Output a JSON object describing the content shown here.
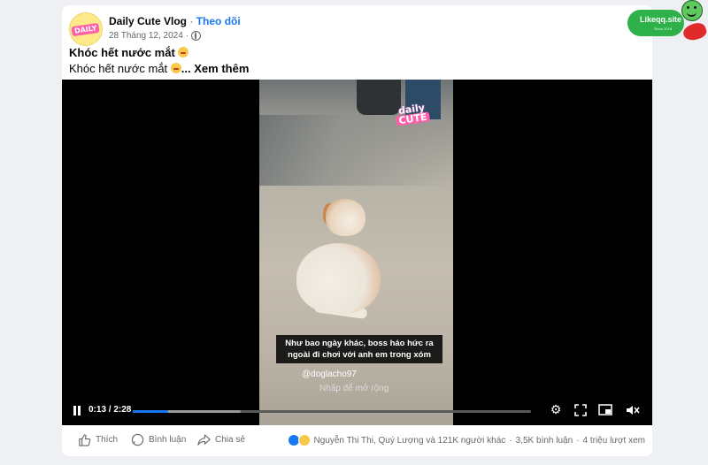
{
  "post": {
    "author": "Daily Cute Vlog",
    "separator": "·",
    "follow_label": "Theo dõi",
    "timestamp": "28 Tháng 12, 2024",
    "title": "Khóc hết nước mắt",
    "description": "Khóc hết nước mắt",
    "see_more_label": "... Xem thêm",
    "avatar_text": "DAILY"
  },
  "video": {
    "caption": "Như bao ngày khác, boss háo hức ra ngoài đi chơi với anh em trong xóm",
    "handle": "@doglacho97",
    "expand_hint": "Nhấp để mở rộng",
    "time": "0:13 / 2:28",
    "progress_fraction": 0.088,
    "buffered_fraction": 0.27,
    "logo_line1": "daily",
    "logo_line2": "CUTE"
  },
  "actions": {
    "like_label": "Thích",
    "comment_label": "Bình luận",
    "share_label": "Chia sẻ"
  },
  "reactions": {
    "summary": "Nguyễn Thi Thi, Quý Lượng và 121K người khác",
    "comments": "3,5K bình luận",
    "views": "4 triệu lượt xem",
    "sep": "·"
  },
  "watermark": {
    "text": "Likeqq.site",
    "sub": "Since 2018"
  },
  "icons": [
    "globe-icon",
    "pause-icon",
    "settings-icon",
    "fullscreen-icon",
    "pip-icon",
    "mute-icon",
    "like-icon",
    "comment-icon",
    "share-icon"
  ]
}
